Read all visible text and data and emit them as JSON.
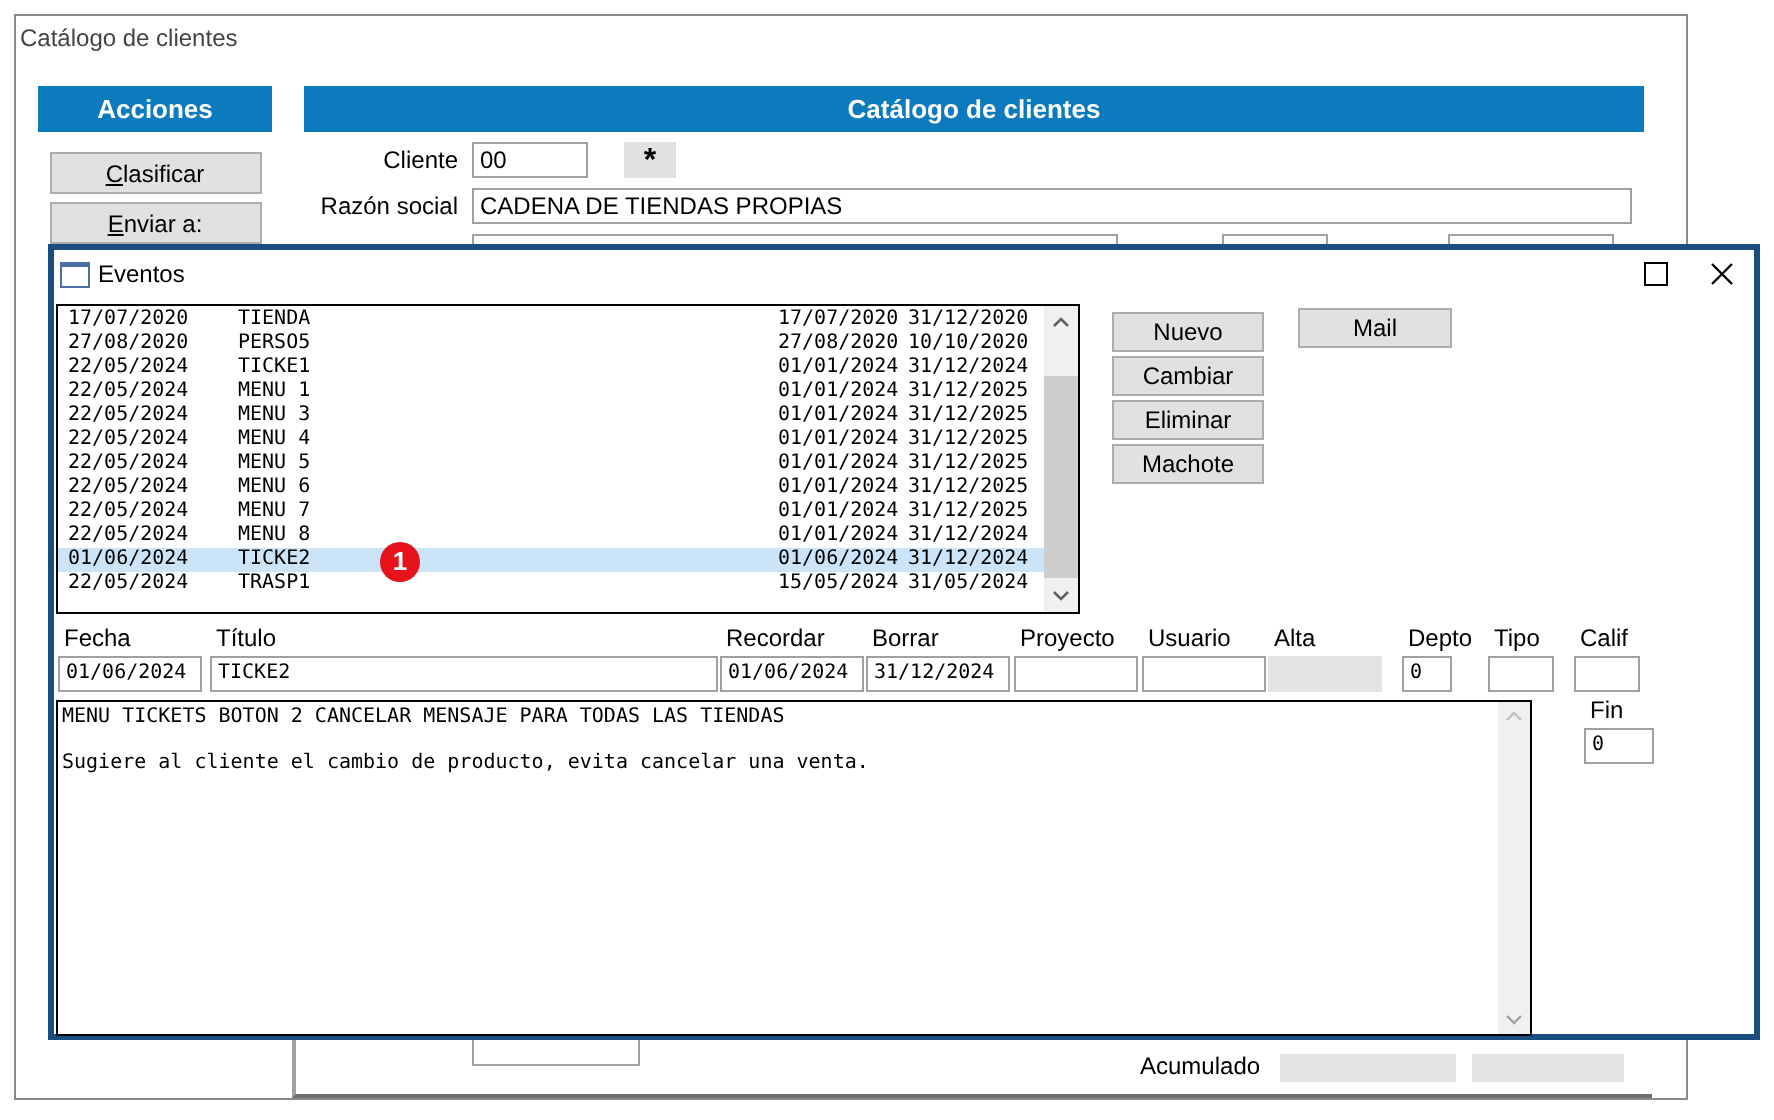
{
  "window": {
    "title": "Catálogo de clientes"
  },
  "actions": {
    "title": "Acciones",
    "buttons": [
      {
        "key": "C",
        "rest": "lasificar"
      },
      {
        "key": "E",
        "rest": "nviar a:"
      }
    ]
  },
  "panel": {
    "title": "Catálogo de clientes",
    "cliente_label": "Cliente",
    "cliente": "00",
    "star_button": "*",
    "razon_label": "Razón social",
    "razon": "CADENA DE TIENDAS PROPIAS",
    "acumulado_label": "Acumulado"
  },
  "dialog": {
    "title": "Eventos",
    "rows": [
      {
        "fecha": "17/07/2020",
        "titulo": "TIENDA",
        "recordar": "17/07/2020",
        "borrar": "31/12/2020",
        "selected": false
      },
      {
        "fecha": "27/08/2020",
        "titulo": "PERSO5",
        "recordar": "27/08/2020",
        "borrar": "10/10/2020",
        "selected": false
      },
      {
        "fecha": "22/05/2024",
        "titulo": "TICKE1",
        "recordar": "01/01/2024",
        "borrar": "31/12/2024",
        "selected": false
      },
      {
        "fecha": "22/05/2024",
        "titulo": "MENU 1",
        "recordar": "01/01/2024",
        "borrar": "31/12/2025",
        "selected": false
      },
      {
        "fecha": "22/05/2024",
        "titulo": "MENU 3",
        "recordar": "01/01/2024",
        "borrar": "31/12/2025",
        "selected": false
      },
      {
        "fecha": "22/05/2024",
        "titulo": "MENU 4",
        "recordar": "01/01/2024",
        "borrar": "31/12/2025",
        "selected": false
      },
      {
        "fecha": "22/05/2024",
        "titulo": "MENU 5",
        "recordar": "01/01/2024",
        "borrar": "31/12/2025",
        "selected": false
      },
      {
        "fecha": "22/05/2024",
        "titulo": "MENU 6",
        "recordar": "01/01/2024",
        "borrar": "31/12/2025",
        "selected": false
      },
      {
        "fecha": "22/05/2024",
        "titulo": "MENU 7",
        "recordar": "01/01/2024",
        "borrar": "31/12/2025",
        "selected": false
      },
      {
        "fecha": "22/05/2024",
        "titulo": "MENU 8",
        "recordar": "01/01/2024",
        "borrar": "31/12/2024",
        "selected": false
      },
      {
        "fecha": "01/06/2024",
        "titulo": "TICKE2",
        "recordar": "01/06/2024",
        "borrar": "31/12/2024",
        "selected": true
      },
      {
        "fecha": "22/05/2024",
        "titulo": "TRASP1",
        "recordar": "15/05/2024",
        "borrar": "31/05/2024",
        "selected": false
      }
    ],
    "badge": "1",
    "buttons": [
      "Nuevo",
      "Cambiar",
      "Eliminar",
      "Machote"
    ],
    "mail_button": "Mail",
    "fields": [
      {
        "label": "Fecha",
        "value": "01/06/2024",
        "kind": "date"
      },
      {
        "label": "Título",
        "value": "TICKE2",
        "kind": "title"
      },
      {
        "label": "Recordar",
        "value": "01/06/2024",
        "kind": "date"
      },
      {
        "label": "Borrar",
        "value": "31/12/2024",
        "kind": "date"
      },
      {
        "label": "Proyecto",
        "kind": "text"
      },
      {
        "label": "Usuario",
        "kind": "text"
      },
      {
        "label": "Alta",
        "kind": "readonly"
      },
      {
        "label": "Depto",
        "value": "0",
        "kind": "small"
      },
      {
        "label": "Tipo",
        "kind": "small"
      },
      {
        "label": "Calif",
        "kind": "small"
      }
    ],
    "notes": [
      "MENU TICKETS BOTON 2 CANCELAR MENSAJE PARA TODAS LAS TIENDAS",
      "Sugiere al cliente el cambio de producto, evita cancelar una venta."
    ],
    "fin_label": "Fin",
    "fin": "0"
  }
}
